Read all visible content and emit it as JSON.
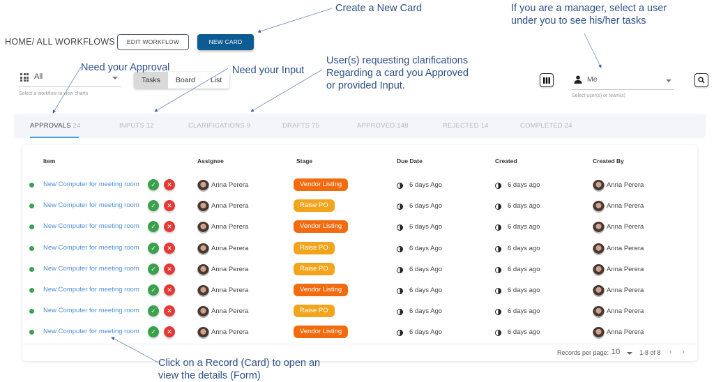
{
  "breadcrumb": "HOME/ ALL WORKFLOWS",
  "toolbar": {
    "edit_workflow_label": "EDIT WORKFLOW",
    "new_card_label": "NEW CARD"
  },
  "workflow_select": {
    "value": "All",
    "hint": "Select a workflow to view charts",
    "icon": "grid-icon"
  },
  "view_toggle": {
    "options": [
      "Tasks",
      "Board",
      "List"
    ],
    "selected": "Tasks"
  },
  "columns_button_icon": "columns-icon",
  "user_select": {
    "value": "Me",
    "hint": "Select user(s) or team(s)",
    "icon": "person-icon"
  },
  "search_button_icon": "search-icon",
  "tabs": [
    {
      "label": "APPROVALS",
      "count": "24",
      "active": true
    },
    {
      "label": "INPUTS",
      "count": "12",
      "active": false
    },
    {
      "label": "CLARIFICATIONS",
      "count": "9",
      "active": false
    },
    {
      "label": "DRAFTS",
      "count": "75",
      "active": false
    },
    {
      "label": "APPROVED",
      "count": "148",
      "active": false
    },
    {
      "label": "REJECTED",
      "count": "14",
      "active": false
    },
    {
      "label": "COMPLETED",
      "count": "24",
      "active": false
    }
  ],
  "table": {
    "headers": [
      "Item",
      "Assignee",
      "Stage",
      "Due Date",
      "Created",
      "Created By"
    ],
    "rows": [
      {
        "item": "New Computer for meeting room",
        "assignee": "Anna Perera",
        "stage": "Vendor Listing",
        "due": "6 days Ago",
        "created": "6 days ago",
        "created_by": "Anna Perera"
      },
      {
        "item": "New Computer for meeting room",
        "assignee": "Anna Perera",
        "stage": "Raise PO",
        "due": "6 days Ago",
        "created": "6 days ago",
        "created_by": "Anna Perera"
      },
      {
        "item": "New Computer for meeting room",
        "assignee": "Anna Perera",
        "stage": "Vendor Listing",
        "due": "6 days Ago",
        "created": "6 days ago",
        "created_by": "Anna Perera"
      },
      {
        "item": "New Computer for meeting room",
        "assignee": "Anna Perera",
        "stage": "Raise PO",
        "due": "6 days Ago",
        "created": "6 days ago",
        "created_by": "Anna Perera"
      },
      {
        "item": "New Computer for meeting room",
        "assignee": "Anna Perera",
        "stage": "Raise PO",
        "due": "6 days Ago",
        "created": "6 days ago",
        "created_by": "Anna Perera"
      },
      {
        "item": "New Computer for meeting room",
        "assignee": "Anna Perera",
        "stage": "Vendor Listing",
        "due": "6 days Ago",
        "created": "6 days ago",
        "created_by": "Anna Perera"
      },
      {
        "item": "New Computer for meeting room",
        "assignee": "Anna Perera",
        "stage": "Raise PO",
        "due": "6 days Ago",
        "created": "6 days ago",
        "created_by": "Anna Perera"
      },
      {
        "item": "New Computer for meeting room",
        "assignee": "Anna Perera",
        "stage": "Vendor Listing",
        "due": "6 days Ago",
        "created": "6 days ago",
        "created_by": "Anna Perera"
      }
    ]
  },
  "stage_colors": {
    "Vendor Listing": "#f26b0f",
    "Raise PO": "#f2a51c"
  },
  "pagination": {
    "records_per_page_label": "Records per page:",
    "records_per_page": "10",
    "range": "1-8 of 8",
    "prev_icon": "chevron-left-icon",
    "next_icon": "chevron-right-icon"
  },
  "annotations": {
    "create_card": "Create a New Card",
    "manager": [
      "If you are a manager, select a user",
      "under you to see his/her tasks"
    ],
    "approval": "Need your Approval",
    "input": "Need your Input",
    "clarifications": [
      "User(s) requesting clarifications",
      "Regarding a card you Approved",
      "or provided Input."
    ],
    "click_record": [
      "Click on a Record (Card) to open an",
      "view the details (Form)"
    ]
  },
  "colors": {
    "primary": "#0e5a93",
    "link": "#4f8fd6",
    "annotation": "#2f4f88",
    "approve": "#3aa14b",
    "reject": "#e53935",
    "tab_underline": "#4a9fd8"
  }
}
